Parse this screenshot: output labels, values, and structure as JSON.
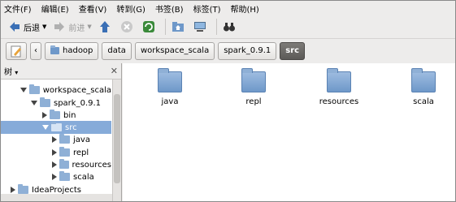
{
  "menu": [
    "文件(F)",
    "编辑(E)",
    "查看(V)",
    "转到(G)",
    "书签(B)",
    "标签(T)",
    "帮助(H)"
  ],
  "toolbar": {
    "back": "后退",
    "forward": "前进"
  },
  "path": [
    "hadoop",
    "data",
    "workspace_scala",
    "spark_0.9.1",
    "src"
  ],
  "sidebar": {
    "title": "树",
    "rows": [
      {
        "label": "workspace_scala",
        "expanded": true
      },
      {
        "label": "spark_0.9.1",
        "expanded": true
      },
      {
        "label": "bin",
        "expanded": false
      },
      {
        "label": "src",
        "expanded": true,
        "selected": true
      },
      {
        "label": "java",
        "expanded": false
      },
      {
        "label": "repl",
        "expanded": false
      },
      {
        "label": "resources",
        "expanded": false
      },
      {
        "label": "scala",
        "expanded": false
      },
      {
        "label": "IdeaProjects",
        "expanded": false
      }
    ]
  },
  "files": [
    "java",
    "repl",
    "resources",
    "scala"
  ],
  "colors": {
    "selection": "#86abd9",
    "folder": "#8fb0d6",
    "active_crumb": "#5c5a57"
  }
}
